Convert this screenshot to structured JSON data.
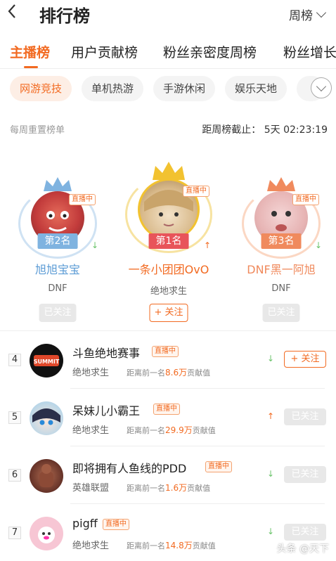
{
  "header": {
    "back_icon": "chevron-left-icon",
    "title": "排行榜",
    "period_label": "周榜"
  },
  "tabs": [
    {
      "label": "主播榜",
      "active": true
    },
    {
      "label": "用户贡献榜"
    },
    {
      "label": "粉丝亲密度周榜"
    },
    {
      "label": "粉丝增长"
    }
  ],
  "chips": [
    {
      "label": "网游竞技",
      "active": true
    },
    {
      "label": "单机热游"
    },
    {
      "label": "手游休闲"
    },
    {
      "label": "娱乐天地"
    }
  ],
  "info": {
    "reset_note": "每周重置榜单",
    "deadline_label": "距周榜截止：",
    "deadline_value": "5天 02:23:19"
  },
  "podium": [
    {
      "rank_label": "第2名",
      "name": "旭旭宝宝",
      "game": "DNF",
      "live": "直播中",
      "follow": "已关注",
      "trend": "down"
    },
    {
      "rank_label": "第1名",
      "name": "一条小团团OvO",
      "game": "绝地求生",
      "live": "直播中",
      "follow": "+ 关注",
      "trend": "up"
    },
    {
      "rank_label": "第3名",
      "name": "DNF黑一阿旭",
      "game": "DNF",
      "live": "直播中",
      "follow": "已关注",
      "trend": "down"
    }
  ],
  "list": [
    {
      "rank": "4",
      "name": "斗鱼绝地赛事",
      "live": "直播中",
      "game": "绝地求生",
      "gap_prefix": "距离前一名",
      "gap_value": "8.6万",
      "gap_suffix": "贡献值",
      "trend": "down",
      "follow": "+ 关注"
    },
    {
      "rank": "5",
      "name": "呆妹儿小霸王",
      "live": "直播中",
      "game": "绝地求生",
      "gap_prefix": "距离前一名",
      "gap_value": "29.9万",
      "gap_suffix": "贡献值",
      "trend": "up",
      "follow": "已关注"
    },
    {
      "rank": "6",
      "name": "即将拥有人鱼线的PDD",
      "live": "直播中",
      "game": "英雄联盟",
      "gap_prefix": "距离前一名",
      "gap_value": "1.6万",
      "gap_suffix": "贡献值",
      "trend": "down",
      "follow": "已关注"
    },
    {
      "rank": "7",
      "name": "pigff",
      "live": "直播中",
      "game": "绝地求生",
      "gap_prefix": "距离前一名",
      "gap_value": "14.8万",
      "gap_suffix": "贡献值",
      "trend": "down",
      "follow": "已关注"
    }
  ],
  "colors": {
    "accent": "#f26a21",
    "up": "#f26a21",
    "down": "#6ac36a",
    "gold": "#f2c230",
    "silver": "#7fb3e0",
    "bronze": "#f08a5d"
  },
  "watermark": "头条 @天下"
}
